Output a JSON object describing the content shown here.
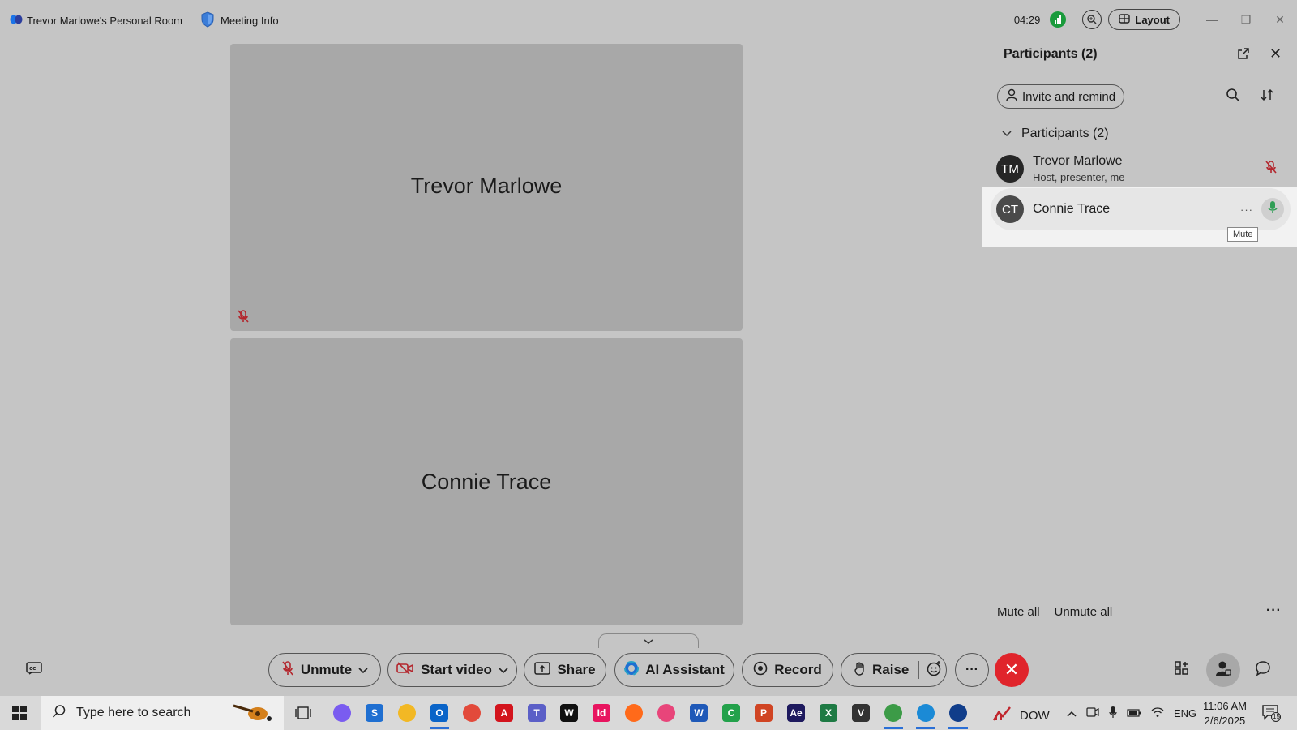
{
  "window": {
    "room_title": "Trevor Marlowe's Personal Room",
    "meeting_info": "Meeting Info",
    "timer": "04:29",
    "layout_label": "Layout"
  },
  "tiles": [
    {
      "name": "Trevor Marlowe",
      "muted": true
    },
    {
      "name": "Connie Trace",
      "muted": false
    }
  ],
  "panel": {
    "title": "Participants (2)",
    "invite_label": "Invite and remind",
    "section_label": "Participants (2)",
    "participants": [
      {
        "initials": "TM",
        "name": "Trevor Marlowe",
        "role": "Host, presenter, me",
        "muted": true
      },
      {
        "initials": "CT",
        "name": "Connie Trace",
        "role": "",
        "muted": false,
        "more": "···"
      }
    ],
    "tooltip": "Mute",
    "mute_all": "Mute all",
    "unmute_all": "Unmute all",
    "more": "···"
  },
  "toolbar": {
    "unmute": "Unmute",
    "start_video": "Start video",
    "share": "Share",
    "ai_assistant": "AI Assistant",
    "record": "Record",
    "raise": "Raise",
    "more": "···"
  },
  "taskbar": {
    "search_placeholder": "Type here to search",
    "ticker": "DOW",
    "language": "ENG",
    "time": "11:06 AM",
    "date": "2/6/2025",
    "notification_count": "15",
    "apps": [
      {
        "name": "copilot-app",
        "color": "#7a5cf0",
        "glyph": "",
        "active": false
      },
      {
        "name": "s-app",
        "color": "#1f6fd1",
        "glyph": "S",
        "active": false
      },
      {
        "name": "file-explorer-app",
        "color": "#f2b824",
        "glyph": "",
        "active": false
      },
      {
        "name": "outlook-app",
        "color": "#0a64c8",
        "glyph": "O",
        "active": true
      },
      {
        "name": "chrome-app",
        "color": "#e24a3b",
        "glyph": "",
        "active": false
      },
      {
        "name": "acrobat-app",
        "color": "#d3141d",
        "glyph": "A",
        "active": false
      },
      {
        "name": "teams-app",
        "color": "#5b5fc7",
        "glyph": "T",
        "active": false
      },
      {
        "name": "webex-app",
        "color": "#111111",
        "glyph": "W",
        "active": false
      },
      {
        "name": "indesign-app",
        "color": "#e8145f",
        "glyph": "Id",
        "active": false
      },
      {
        "name": "firefox-app",
        "color": "#ff6a1a",
        "glyph": "",
        "active": false
      },
      {
        "name": "creative-cloud-app",
        "color": "#e8457a",
        "glyph": "",
        "active": false
      },
      {
        "name": "word-app",
        "color": "#1f59b8",
        "glyph": "W",
        "active": false
      },
      {
        "name": "c-app",
        "color": "#23a14b",
        "glyph": "C",
        "active": false
      },
      {
        "name": "powerpoint-app",
        "color": "#d04423",
        "glyph": "P",
        "active": false
      },
      {
        "name": "after-effects-app",
        "color": "#1e1a5e",
        "glyph": "Ae",
        "active": false
      },
      {
        "name": "excel-app",
        "color": "#1e7a44",
        "glyph": "X",
        "active": false
      },
      {
        "name": "v-app",
        "color": "#333333",
        "glyph": "V",
        "active": false
      },
      {
        "name": "chrome-profile-app",
        "color": "#3c9b47",
        "glyph": "",
        "active": true
      },
      {
        "name": "edge-app",
        "color": "#1b8ad6",
        "glyph": "",
        "active": true
      },
      {
        "name": "webex-meeting-app",
        "color": "#103d8a",
        "glyph": "",
        "active": true
      }
    ]
  }
}
